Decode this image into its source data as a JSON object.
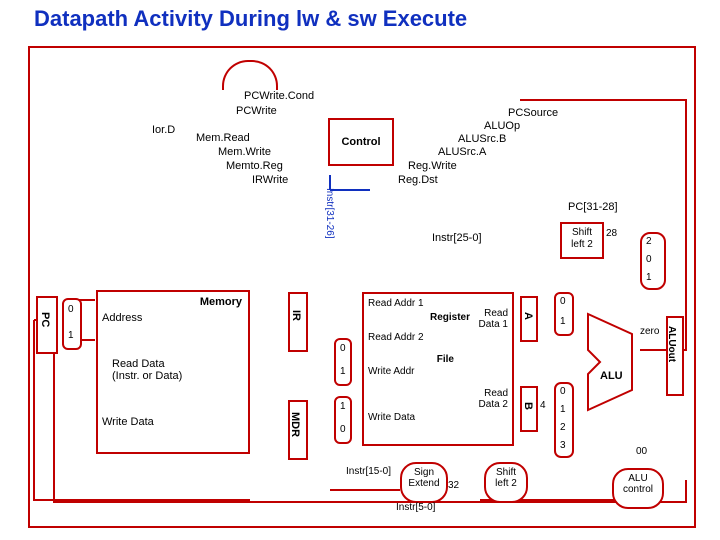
{
  "title": "Datapath Activity During lw & sw Execute",
  "control_block": "Control",
  "control_signals": {
    "pcwrite_cond": "PCWrite.Cond",
    "pcwrite": "PCWrite",
    "iord": "Ior.D",
    "memread": "Mem.Read",
    "memwrite": "Mem.Write",
    "memtoreg": "Memto.Reg",
    "irwrite": "IRWrite",
    "pcsource": "PCSource",
    "aluop": "ALUOp",
    "alusrcb": "ALUSrc.B",
    "alusrca": "ALUSrc.A",
    "regwrite": "Reg.Write",
    "regdst": "Reg.Dst"
  },
  "pc": "PC",
  "memory": {
    "title": "Memory",
    "address": "Address",
    "read_data": "Read Data\n(Instr. or Data)",
    "write_data": "Write Data"
  },
  "ir": "IR",
  "mdr": "MDR",
  "regfile": {
    "read_addr1": "Read Addr 1",
    "read_addr2": "Read Addr 2",
    "write_addr": "Write Addr",
    "write_data": "Write Data",
    "register": "Register",
    "file": "File",
    "read_data1": "Read\nData 1",
    "read_data2": "Read\nData 2"
  },
  "A": "A",
  "B": "B",
  "alu": "ALU",
  "alu_zero": "zero",
  "aluout": "ALUout",
  "alu_ctrl": "ALU\ncontrol",
  "sign_ext": "Sign\nExtend",
  "shift2a": "Shift\nleft 2",
  "shift2b": "Shift\nleft 2",
  "bus_labels": {
    "instr31_26": "Instr[31-26]",
    "instr25_0": "Instr[25-0]",
    "instr15_0": "Instr[15-0]",
    "instr5_0": "Instr[5-0]",
    "pc31_28": "PC[31-28]",
    "n28": "28",
    "n32": "32",
    "n4": "4",
    "n00": "00"
  },
  "mux": {
    "n0": "0",
    "n1": "1",
    "n2": "2",
    "n3": "3"
  }
}
